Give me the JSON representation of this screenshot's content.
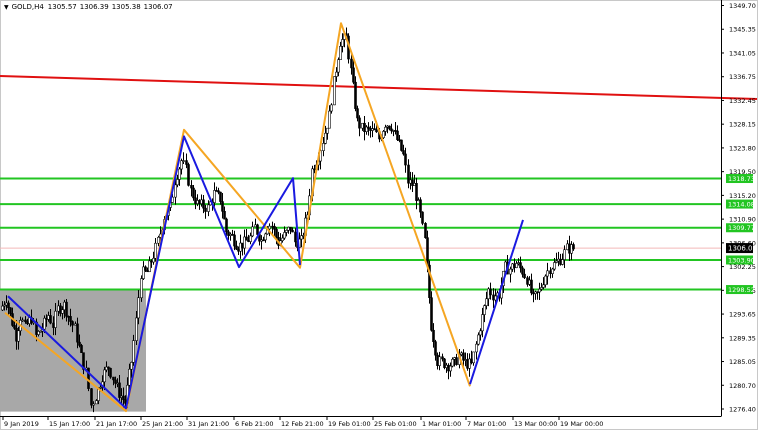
{
  "header": {
    "menu_icon": "triangle-down-icon",
    "symbol": "GOLD,H4",
    "quotes": [
      "1305.57",
      "1306.39",
      "1305.38",
      "1306.07"
    ]
  },
  "chart_data": {
    "type": "candlestick",
    "y_axis_labels": [
      "1349.70",
      "1345.35",
      "1341.05",
      "1336.75",
      "1332.45",
      "1328.15",
      "1323.80",
      "1319.50",
      "1315.20",
      "1310.90",
      "1306.60",
      "1302.25",
      "1297.95",
      "1293.65",
      "1289.35",
      "1285.05",
      "1280.70",
      "1276.40"
    ],
    "x_axis_labels": [
      "9 Jan 2019",
      "15 Jan 17:00",
      "21 Jan 17:00",
      "25 Jan 21:00",
      "31 Jan 21:00",
      "6 Feb 21:00",
      "12 Feb 21:00",
      "19 Feb 01:00",
      "25 Feb 01:00",
      "1 Mar 01:00",
      "7 Mar 01:00",
      "13 Mar 00:00",
      "19 Mar 00:00"
    ],
    "ylim": [
      1275.5,
      1350.5
    ],
    "current_price": "1306.07",
    "horizontal_levels": [
      {
        "value": 1318.73,
        "label": "1318.73",
        "color": "#22c522"
      },
      {
        "value": 1314.08,
        "label": "1314.08",
        "color": "#22c522"
      },
      {
        "value": 1309.77,
        "label": "1309.77",
        "color": "#22c522"
      },
      {
        "value": 1303.9,
        "label": "1303.90",
        "color": "#22c522"
      },
      {
        "value": 1298.52,
        "label": "1298.52",
        "color": "#22c522"
      }
    ],
    "trend_line": {
      "from": [
        0,
        1337.4
      ],
      "to": [
        757,
        1333.2
      ],
      "color": "#e01010"
    },
    "shaded_region": {
      "x_from": 0,
      "x_to": 146,
      "y_top": 1298.4,
      "y_bottom": 1276.3,
      "color": "#a8a8a8"
    },
    "orange_pattern": [
      [
        5,
        1294.3
      ],
      [
        126,
        1276.4
      ],
      [
        184,
        1327.6
      ],
      [
        300,
        1302.5
      ],
      [
        341,
        1347.0
      ],
      [
        470,
        1280.9
      ]
    ],
    "blue_pattern_1": [
      [
        8,
        1297.3
      ],
      [
        126,
        1276.9
      ],
      [
        184,
        1326.4
      ],
      [
        239,
        1302.6
      ],
      [
        293,
        1318.8
      ],
      [
        300,
        1303.0
      ]
    ],
    "blue_pattern_2": [
      [
        470,
        1281.3
      ],
      [
        523,
        1311.2
      ]
    ],
    "price_series": [
      [
        2,
        1294.8
      ],
      [
        8,
        1297.0
      ],
      [
        12,
        1293.8
      ],
      [
        18,
        1290.1
      ],
      [
        22,
        1293.6
      ],
      [
        27,
        1291.6
      ],
      [
        33,
        1293.4
      ],
      [
        38,
        1290.1
      ],
      [
        44,
        1291.5
      ],
      [
        50,
        1293.9
      ],
      [
        55,
        1292.1
      ],
      [
        60,
        1295.0
      ],
      [
        66,
        1295.7
      ],
      [
        72,
        1292.8
      ],
      [
        77,
        1291.4
      ],
      [
        83,
        1286.3
      ],
      [
        88,
        1283.5
      ],
      [
        93,
        1277.5
      ],
      [
        98,
        1279.1
      ],
      [
        104,
        1282.8
      ],
      [
        110,
        1284.5
      ],
      [
        115,
        1282.5
      ],
      [
        121,
        1279.7
      ],
      [
        127,
        1278.0
      ],
      [
        133,
        1285.4
      ],
      [
        138,
        1292.8
      ],
      [
        143,
        1301.5
      ],
      [
        149,
        1301.7
      ],
      [
        155,
        1304.8
      ],
      [
        160,
        1307.3
      ],
      [
        166,
        1311.8
      ],
      [
        172,
        1313.5
      ],
      [
        177,
        1318.4
      ],
      [
        183,
        1322.0
      ],
      [
        188,
        1320.3
      ],
      [
        193,
        1316.5
      ],
      [
        199,
        1314.1
      ],
      [
        205,
        1313.7
      ],
      [
        210,
        1313.4
      ],
      [
        216,
        1316.0
      ],
      [
        222,
        1315.1
      ],
      [
        228,
        1309.1
      ],
      [
        234,
        1308.1
      ],
      [
        240,
        1306.4
      ],
      [
        246,
        1307.0
      ],
      [
        252,
        1308.0
      ],
      [
        257,
        1309.9
      ],
      [
        263,
        1307.5
      ],
      [
        269,
        1310.4
      ],
      [
        274,
        1310.1
      ],
      [
        280,
        1307.1
      ],
      [
        286,
        1308.3
      ],
      [
        292,
        1309.8
      ],
      [
        297,
        1307.2
      ],
      [
        303,
        1307.3
      ],
      [
        309,
        1312.3
      ],
      [
        314,
        1320.3
      ],
      [
        320,
        1323.0
      ],
      [
        325,
        1325.7
      ],
      [
        331,
        1330.2
      ],
      [
        336,
        1336.2
      ],
      [
        342,
        1343.7
      ],
      [
        348,
        1344.3
      ],
      [
        353,
        1338.3
      ],
      [
        359,
        1329.1
      ],
      [
        364,
        1327.8
      ],
      [
        370,
        1327.4
      ],
      [
        376,
        1327.2
      ],
      [
        381,
        1326.0
      ],
      [
        387,
        1328.8
      ],
      [
        393,
        1328.3
      ],
      [
        399,
        1325.8
      ],
      [
        405,
        1322.9
      ],
      [
        410,
        1318.2
      ],
      [
        416,
        1317.4
      ],
      [
        422,
        1312.0
      ],
      [
        427,
        1307.3
      ],
      [
        433,
        1292.0
      ],
      [
        439,
        1285.5
      ],
      [
        444,
        1285.3
      ],
      [
        450,
        1284.8
      ],
      [
        456,
        1285.1
      ],
      [
        461,
        1286.5
      ],
      [
        467,
        1285.2
      ],
      [
        473,
        1284.8
      ],
      [
        478,
        1288.4
      ],
      [
        484,
        1293.5
      ],
      [
        490,
        1298.5
      ],
      [
        495,
        1297.5
      ],
      [
        501,
        1297.7
      ],
      [
        507,
        1302.5
      ],
      [
        512,
        1302.3
      ],
      [
        518,
        1303.3
      ],
      [
        524,
        1301.9
      ],
      [
        529,
        1300.5
      ],
      [
        535,
        1296.7
      ],
      [
        541,
        1298.2
      ],
      [
        547,
        1301.3
      ],
      [
        552,
        1302.5
      ],
      [
        558,
        1303.4
      ],
      [
        564,
        1304.5
      ],
      [
        569,
        1306.0
      ],
      [
        575,
        1306.0
      ]
    ]
  }
}
